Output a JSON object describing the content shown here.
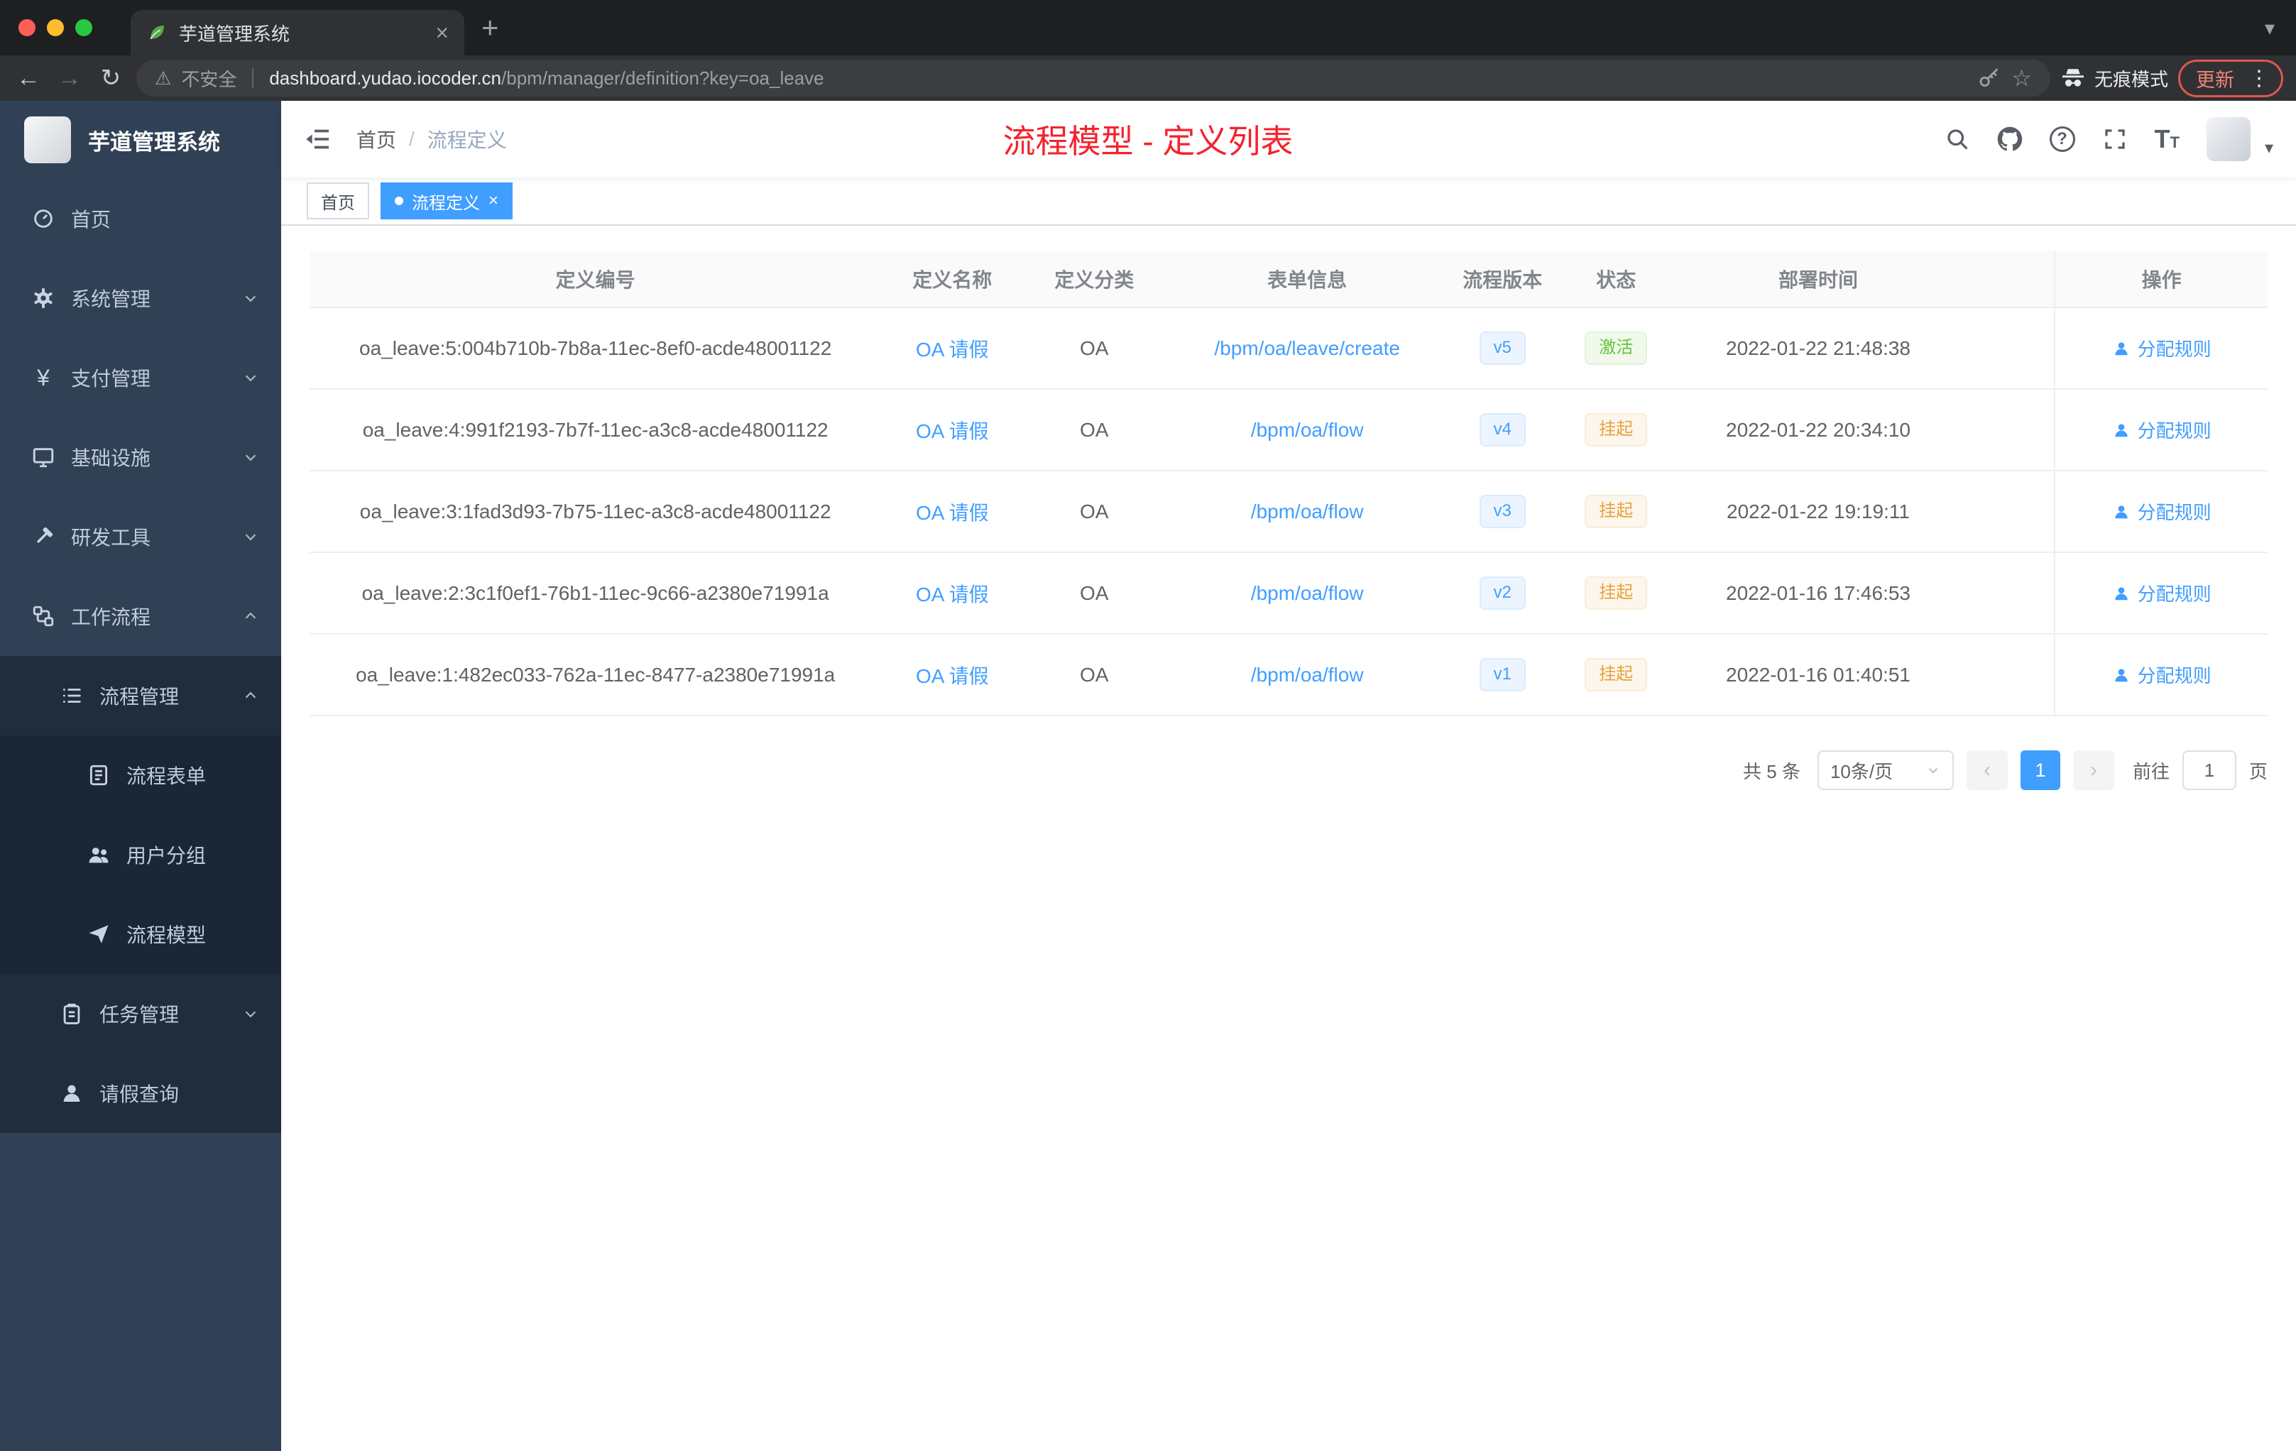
{
  "browser": {
    "tab_title": "芋道管理系统",
    "security_label": "不安全",
    "url_domain": "dashboard.yudao.iocoder.cn",
    "url_path": "/bpm/manager/definition?key=oa_leave",
    "incognito_label": "无痕模式",
    "update_label": "更新"
  },
  "icons": {
    "back": "←",
    "forward": "→",
    "reload": "↻",
    "warning": "⚠",
    "star": "☆",
    "close": "×",
    "plus": "+",
    "menu_dots": "⋮",
    "caret_down": "▾",
    "question": "?",
    "yen": "¥",
    "font_size_glyph": "T",
    "prev": "‹",
    "next": "›",
    "breadcrumb_sep": "/"
  },
  "sidebar": {
    "logo_title": "芋道管理系统",
    "items": [
      {
        "label": "首页",
        "level": 1
      },
      {
        "label": "系统管理",
        "level": 1,
        "chevron": "down"
      },
      {
        "label": "支付管理",
        "level": 1,
        "chevron": "down"
      },
      {
        "label": "基础设施",
        "level": 1,
        "chevron": "down"
      },
      {
        "label": "研发工具",
        "level": 1,
        "chevron": "down"
      },
      {
        "label": "工作流程",
        "level": 1,
        "chevron": "up"
      },
      {
        "label": "流程管理",
        "level": 2,
        "chevron": "up"
      },
      {
        "label": "流程表单",
        "level": 3
      },
      {
        "label": "用户分组",
        "level": 3
      },
      {
        "label": "流程模型",
        "level": 3
      },
      {
        "label": "任务管理",
        "level": 2,
        "chevron": "down"
      },
      {
        "label": "请假查询",
        "level": 2
      }
    ]
  },
  "header": {
    "breadcrumb": [
      "首页",
      "流程定义"
    ],
    "page_title": "流程模型 - 定义列表"
  },
  "tags": {
    "items": [
      {
        "label": "首页",
        "active": false
      },
      {
        "label": "流程定义",
        "active": true
      }
    ]
  },
  "table": {
    "headers": [
      "定义编号",
      "定义名称",
      "定义分类",
      "表单信息",
      "流程版本",
      "状态",
      "部署时间",
      "操作"
    ],
    "action_label": "分配规则",
    "rows": [
      {
        "id": "oa_leave:5:004b710b-7b8a-11ec-8ef0-acde48001122",
        "name": "OA 请假",
        "category": "OA",
        "form": "/bpm/oa/leave/create",
        "version": "v5",
        "status": "激活",
        "status_type": "success",
        "time": "2022-01-22 21:48:38"
      },
      {
        "id": "oa_leave:4:991f2193-7b7f-11ec-a3c8-acde48001122",
        "name": "OA 请假",
        "category": "OA",
        "form": "/bpm/oa/flow",
        "version": "v4",
        "status": "挂起",
        "status_type": "warning",
        "time": "2022-01-22 20:34:10"
      },
      {
        "id": "oa_leave:3:1fad3d93-7b75-11ec-a3c8-acde48001122",
        "name": "OA 请假",
        "category": "OA",
        "form": "/bpm/oa/flow",
        "version": "v3",
        "status": "挂起",
        "status_type": "warning",
        "time": "2022-01-22 19:19:11"
      },
      {
        "id": "oa_leave:2:3c1f0ef1-76b1-11ec-9c66-a2380e71991a",
        "name": "OA 请假",
        "category": "OA",
        "form": "/bpm/oa/flow",
        "version": "v2",
        "status": "挂起",
        "status_type": "warning",
        "time": "2022-01-16 17:46:53"
      },
      {
        "id": "oa_leave:1:482ec033-762a-11ec-8477-a2380e71991a",
        "name": "OA 请假",
        "category": "OA",
        "form": "/bpm/oa/flow",
        "version": "v1",
        "status": "挂起",
        "status_type": "warning",
        "time": "2022-01-16 01:40:51"
      }
    ]
  },
  "pagination": {
    "total": "共 5 条",
    "page_size": "10条/页",
    "current_page": "1",
    "goto_label": "前往",
    "goto_value": "1",
    "unit_label": "页"
  },
  "colors": {
    "accent": "#409eff",
    "success": "#67c23a",
    "warning": "#e6a23c",
    "title_red": "#f5222d",
    "sidebar_bg": "#304156",
    "submenu_bg": "#1f2d3d"
  }
}
